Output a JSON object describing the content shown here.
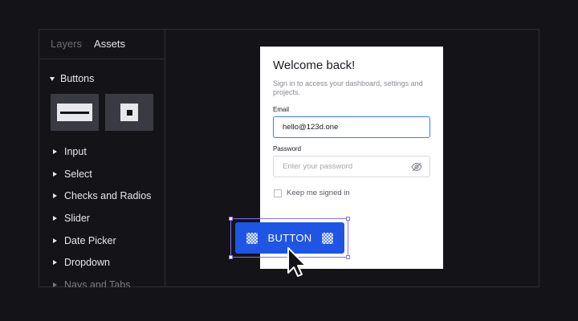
{
  "panel": {
    "tabs": [
      {
        "label": "Layers"
      },
      {
        "label": "Assets"
      }
    ],
    "section": {
      "label": "Buttons"
    },
    "items": [
      {
        "label": "Input"
      },
      {
        "label": "Select"
      },
      {
        "label": "Checks and Radios"
      },
      {
        "label": "Slider"
      },
      {
        "label": "Date Picker"
      },
      {
        "label": "Dropdown"
      },
      {
        "label": "Navs and Tabs"
      }
    ]
  },
  "login": {
    "title": "Welcome back!",
    "subtitle": "Sign in to access your dashboard, settings and projects.",
    "email_label": "Email",
    "email_value": "hello@123d.one",
    "password_label": "Password",
    "password_placeholder": "Enter your password",
    "remember_label": "Keep me signed in"
  },
  "selection": {
    "button_label": "BUTTON"
  },
  "colors": {
    "background": "#141418",
    "accent": "#1f55e5",
    "selection": "#8e6cf0"
  }
}
